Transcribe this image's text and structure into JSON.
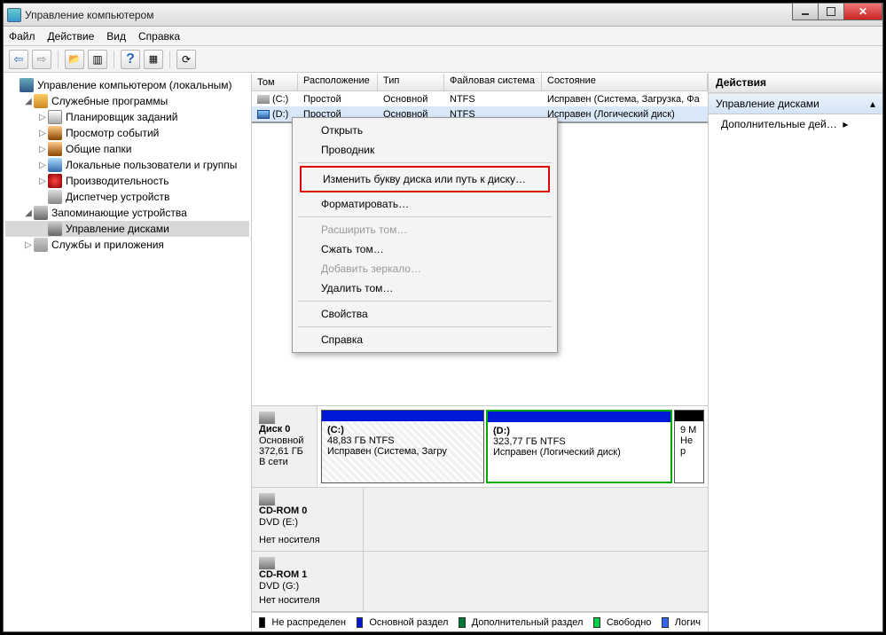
{
  "window": {
    "title": "Управление компьютером"
  },
  "menu": {
    "file": "Файл",
    "action": "Действие",
    "view": "Вид",
    "help": "Справка"
  },
  "tree": {
    "root": "Управление компьютером (локальным)",
    "sys_tools": "Служебные программы",
    "task_sched": "Планировщик заданий",
    "event_viewer": "Просмотр событий",
    "shared_folders": "Общие папки",
    "local_users": "Локальные пользователи и группы",
    "performance": "Производительность",
    "device_mgr": "Диспетчер устройств",
    "storage": "Запоминающие устройства",
    "disk_mgmt": "Управление дисками",
    "services_apps": "Службы и приложения"
  },
  "vol_headers": {
    "volume": "Том",
    "layout": "Расположение",
    "type": "Тип",
    "fs": "Файловая система",
    "status": "Состояние"
  },
  "volumes": [
    {
      "name": "(C:)",
      "layout": "Простой",
      "type": "Основной",
      "fs": "NTFS",
      "status": "Исправен (Система, Загрузка, Фа"
    },
    {
      "name": "(D:)",
      "layout": "Простой",
      "type": "Основной",
      "fs": "NTFS",
      "status": "Исправен (Логический диск)"
    }
  ],
  "disk0": {
    "label": "Диск 0",
    "type": "Основной",
    "size": "372,61 ГБ",
    "state": "В сети",
    "part_c": {
      "name": "(C:)",
      "fs": "48,83 ГБ NTFS",
      "status": "Исправен (Система, Загру"
    },
    "part_d": {
      "name": "(D:)",
      "fs": "323,77 ГБ NTFS",
      "status": "Исправен (Логический диск)"
    },
    "unalloc": {
      "l1": "9 M",
      "l2": "Не р"
    }
  },
  "cd0": {
    "label": "CD-ROM 0",
    "type": "DVD (E:)",
    "state": "Нет носителя"
  },
  "cd1": {
    "label": "CD-ROM 1",
    "type": "DVD (G:)",
    "state": "Нет носителя"
  },
  "legend": {
    "unalloc": "Не распределен",
    "primary": "Основной раздел",
    "ext": "Дополнительный раздел",
    "free": "Свободно",
    "logical": "Логич"
  },
  "actions": {
    "header": "Действия",
    "disk_mgmt": "Управление дисками",
    "more": "Дополнительные дей…"
  },
  "ctx": {
    "open": "Открыть",
    "explorer": "Проводник",
    "change_letter": "Изменить букву диска или путь к диску…",
    "format": "Форматировать…",
    "extend": "Расширить том…",
    "shrink": "Сжать том…",
    "mirror": "Добавить зеркало…",
    "delete": "Удалить том…",
    "properties": "Свойства",
    "help": "Справка"
  }
}
